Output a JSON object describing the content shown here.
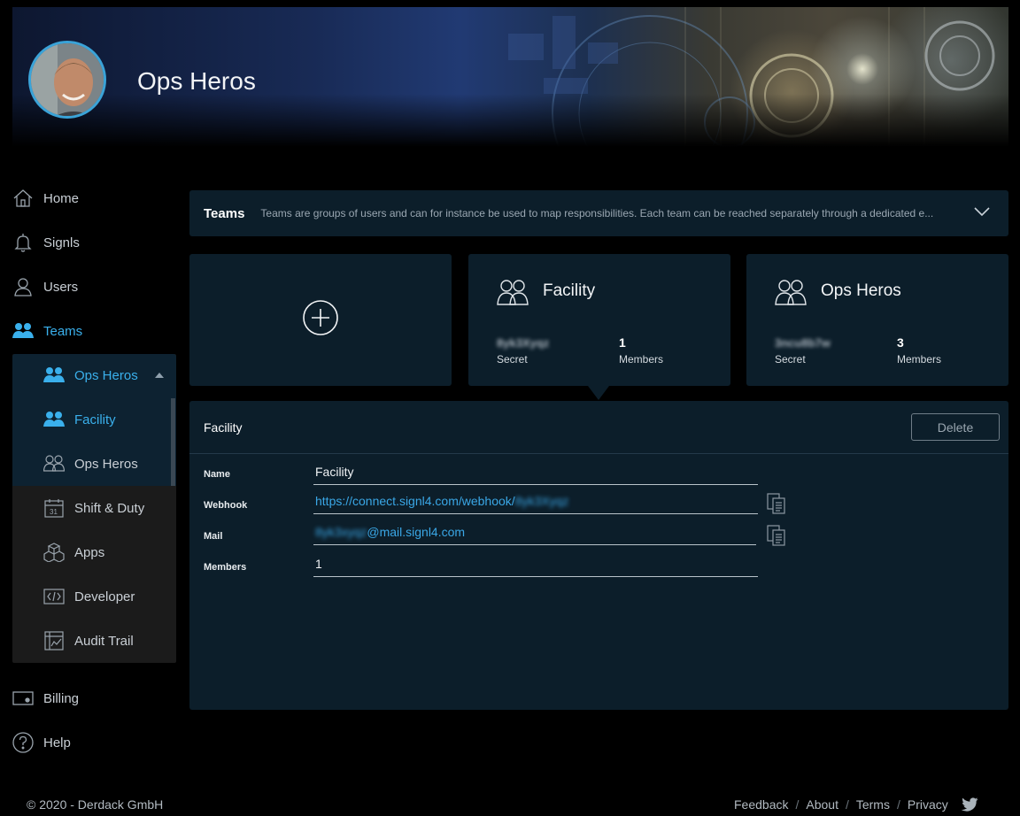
{
  "header": {
    "title": "Ops Heros"
  },
  "sidebar": {
    "items": [
      {
        "label": "Home",
        "icon": "home-icon"
      },
      {
        "label": "Signls",
        "icon": "bell-icon"
      },
      {
        "label": "Users",
        "icon": "user-icon"
      },
      {
        "label": "Teams",
        "icon": "team-icon",
        "active": true
      }
    ],
    "subitems": [
      {
        "label": "Ops Heros",
        "icon": "team-icon",
        "active": true
      },
      {
        "label": "Facility",
        "icon": "team-icon",
        "active": true
      },
      {
        "label": "Ops Heros",
        "icon": "team-outline-icon"
      },
      {
        "label": "Shift & Duty",
        "icon": "calendar-icon"
      },
      {
        "label": "Apps",
        "icon": "cubes-icon"
      },
      {
        "label": "Developer",
        "icon": "code-icon"
      },
      {
        "label": "Audit Trail",
        "icon": "audit-icon"
      }
    ],
    "bottom": [
      {
        "label": "Billing",
        "icon": "card-icon"
      },
      {
        "label": "Help",
        "icon": "help-icon"
      }
    ]
  },
  "teams_bar": {
    "title": "Teams",
    "description": "Teams are groups of users and can for instance be used to map responsibilities. Each team can be reached separately through a dedicated e..."
  },
  "cards": [
    {
      "name": "Facility",
      "secret": "8yk3Xyqz",
      "secret_label": "Secret",
      "members": "1",
      "members_label": "Members"
    },
    {
      "name": "Ops Heros",
      "secret": "3ncu8b7w",
      "secret_label": "Secret",
      "members": "3",
      "members_label": "Members"
    }
  ],
  "detail": {
    "title": "Facility",
    "delete_label": "Delete",
    "fields": {
      "name_label": "Name",
      "name_value": "Facility",
      "webhook_label": "Webhook",
      "webhook_prefix": "https://connect.signl4.com/webhook/",
      "webhook_secret": "8yk3Xyqz",
      "mail_label": "Mail",
      "mail_prefix": "8yk3xyqz",
      "mail_suffix": "@mail.signl4.com",
      "members_label": "Members",
      "members_value": "1"
    }
  },
  "footer": {
    "copyright": "© 2020 - Derdack GmbH",
    "links": [
      "Feedback",
      "About",
      "Terms",
      "Privacy"
    ]
  },
  "colors": {
    "accent": "#3ab0ec",
    "panel": "#0c1e2a",
    "background": "#000000"
  }
}
